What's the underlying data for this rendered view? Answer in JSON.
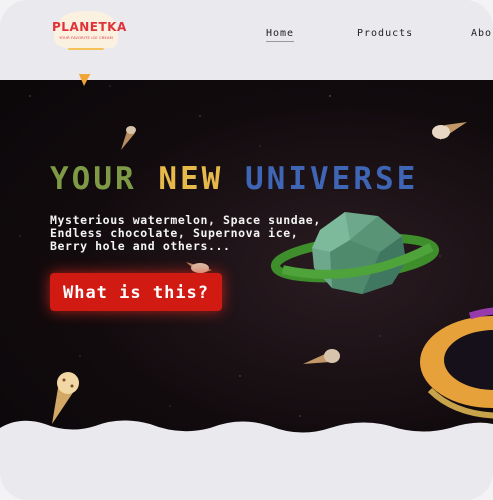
{
  "logo": {
    "title": "PLANETKA",
    "subtitle": "YOUR FAVORITE ICE CREAM"
  },
  "nav": {
    "items": [
      "Home",
      "Products",
      "Abo"
    ],
    "active": "Home"
  },
  "hero": {
    "headline": [
      "YOUR",
      "NEW",
      "UNIVERSE"
    ],
    "description_lines": [
      "Mysterious watermelon, Space sundae,",
      "Endless chocolate, Supernova ice,",
      "Berry hole and others..."
    ],
    "cta_label": "What is this?"
  },
  "colors": {
    "headline_word1": "#7e9a45",
    "headline_word2": "#e6b94a",
    "headline_word3": "#3f66b5",
    "cta_background": "#d11a12",
    "logo_red": "#e0323a",
    "space_background": "#120b0e",
    "page_background": "#e9e9ee"
  },
  "decor": {
    "icons": [
      "ice-cream-cone-icon",
      "green-planet-icon",
      "planet-ring-icon",
      "donut-planet-icon",
      "star-icon"
    ]
  }
}
